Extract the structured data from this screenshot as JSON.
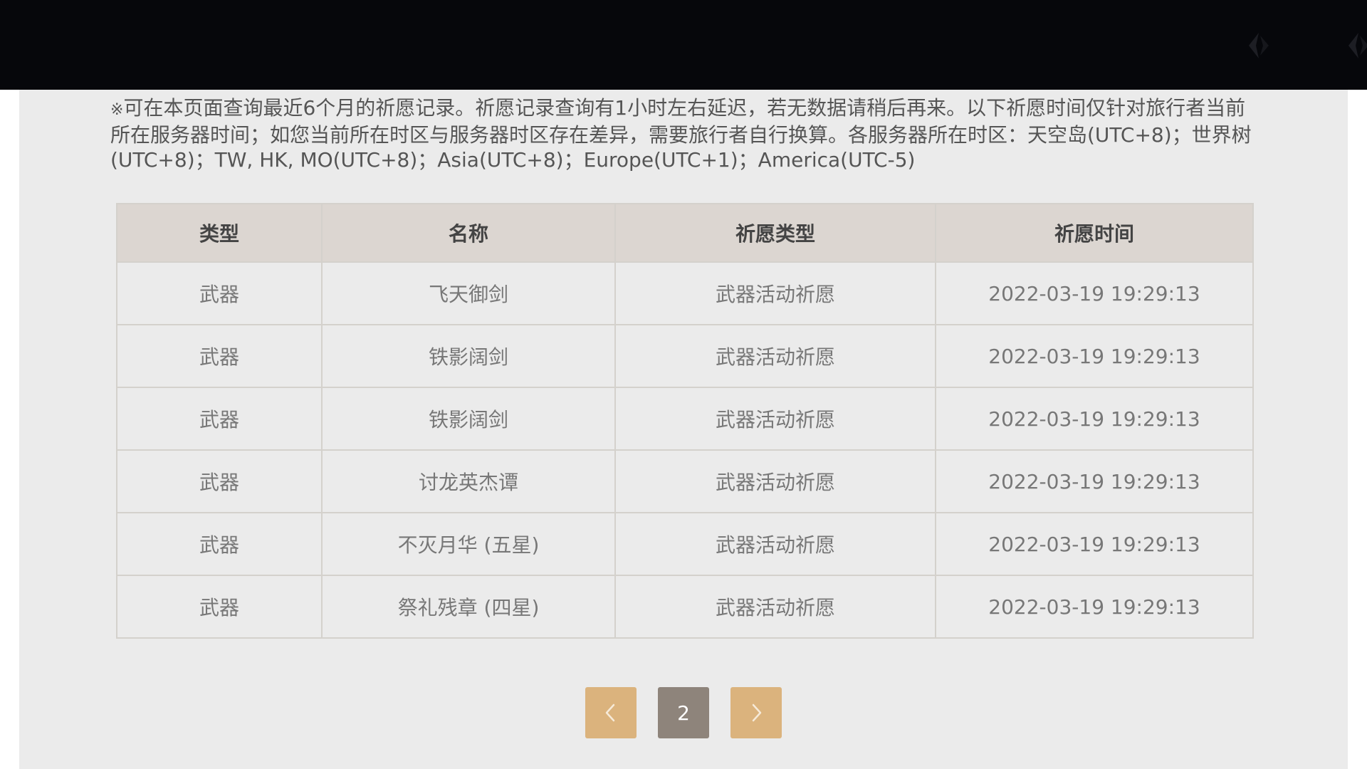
{
  "notice": {
    "mark": "※",
    "text": "可在本页面查询最近6个月的祈愿记录。祈愿记录查询有1小时左右延迟，若无数据请稍后再来。以下祈愿时间仅针对旅行者当前所在服务器时间；如您当前所在时区与服务器时区存在差异，需要旅行者自行换算。各服务器所在时区：天空岛(UTC+8)；世界树(UTC+8)；TW, HK, MO(UTC+8)；Asia(UTC+8)；Europe(UTC+1)；America(UTC-5)"
  },
  "table": {
    "headers": [
      "类型",
      "名称",
      "祈愿类型",
      "祈愿时间"
    ],
    "rows": [
      {
        "type": "武器",
        "name": "飞天御剑",
        "wish_type": "武器活动祈愿",
        "time": "2022-03-19 19:29:13"
      },
      {
        "type": "武器",
        "name": "铁影阔剑",
        "wish_type": "武器活动祈愿",
        "time": "2022-03-19 19:29:13"
      },
      {
        "type": "武器",
        "name": "铁影阔剑",
        "wish_type": "武器活动祈愿",
        "time": "2022-03-19 19:29:13"
      },
      {
        "type": "武器",
        "name": "讨龙英杰谭",
        "wish_type": "武器活动祈愿",
        "time": "2022-03-19 19:29:13"
      },
      {
        "type": "武器",
        "name": "不灭月华 (五星)",
        "wish_type": "武器活动祈愿",
        "time": "2022-03-19 19:29:13"
      },
      {
        "type": "武器",
        "name": "祭礼残章 (四星)",
        "wish_type": "武器活动祈愿",
        "time": "2022-03-19 19:29:13"
      }
    ]
  },
  "pagination": {
    "current_page": "2",
    "prev_icon": "chevron-left-icon",
    "next_icon": "chevron-right-icon"
  },
  "colors": {
    "five_star": "#bd6932",
    "four_star": "#a256e1",
    "pager_button": "#dbb37d",
    "pager_current": "#8e847b",
    "top_bar": "#06070b"
  }
}
